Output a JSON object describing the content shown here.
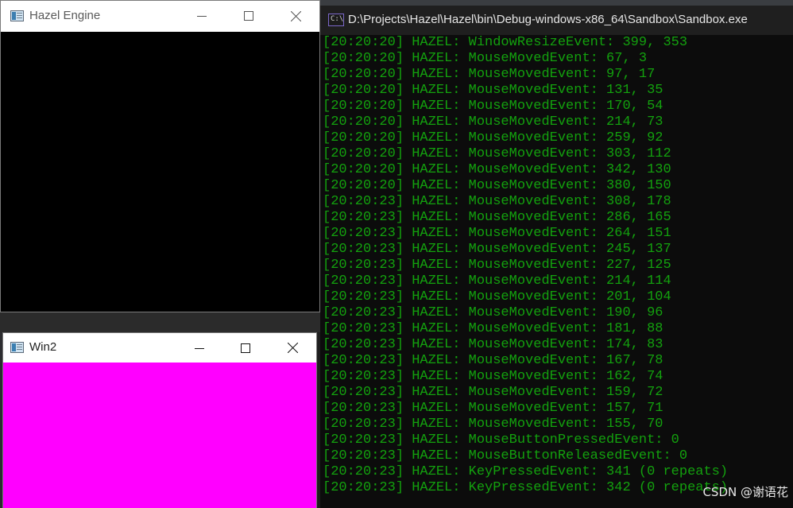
{
  "hazel_window": {
    "title": "Hazel Engine",
    "client_color": "#000000"
  },
  "win2_window": {
    "title": "Win2",
    "client_color": "#ff00ff"
  },
  "console_window": {
    "title": "D:\\Projects\\Hazel\\Hazel\\bin\\Debug-windows-x86_64\\Sandbox\\Sandbox.exe",
    "icon_text": "C:\\",
    "text_color": "#13a10e",
    "lines": [
      "[20:20:20] HAZEL: WindowResizeEvent: 399, 353",
      "[20:20:20] HAZEL: MouseMovedEvent: 67, 3",
      "[20:20:20] HAZEL: MouseMovedEvent: 97, 17",
      "[20:20:20] HAZEL: MouseMovedEvent: 131, 35",
      "[20:20:20] HAZEL: MouseMovedEvent: 170, 54",
      "[20:20:20] HAZEL: MouseMovedEvent: 214, 73",
      "[20:20:20] HAZEL: MouseMovedEvent: 259, 92",
      "[20:20:20] HAZEL: MouseMovedEvent: 303, 112",
      "[20:20:20] HAZEL: MouseMovedEvent: 342, 130",
      "[20:20:20] HAZEL: MouseMovedEvent: 380, 150",
      "[20:20:23] HAZEL: MouseMovedEvent: 308, 178",
      "[20:20:23] HAZEL: MouseMovedEvent: 286, 165",
      "[20:20:23] HAZEL: MouseMovedEvent: 264, 151",
      "[20:20:23] HAZEL: MouseMovedEvent: 245, 137",
      "[20:20:23] HAZEL: MouseMovedEvent: 227, 125",
      "[20:20:23] HAZEL: MouseMovedEvent: 214, 114",
      "[20:20:23] HAZEL: MouseMovedEvent: 201, 104",
      "[20:20:23] HAZEL: MouseMovedEvent: 190, 96",
      "[20:20:23] HAZEL: MouseMovedEvent: 181, 88",
      "[20:20:23] HAZEL: MouseMovedEvent: 174, 83",
      "[20:20:23] HAZEL: MouseMovedEvent: 167, 78",
      "[20:20:23] HAZEL: MouseMovedEvent: 162, 74",
      "[20:20:23] HAZEL: MouseMovedEvent: 159, 72",
      "[20:20:23] HAZEL: MouseMovedEvent: 157, 71",
      "[20:20:23] HAZEL: MouseMovedEvent: 155, 70",
      "[20:20:23] HAZEL: MouseButtonPressedEvent: 0",
      "[20:20:23] HAZEL: MouseButtonReleasedEvent: 0",
      "[20:20:23] HAZEL: KeyPressedEvent: 341 (0 repeats)",
      "[20:20:23] HAZEL: KeyPressedEvent: 342 (0 repeats)"
    ]
  },
  "icons": {
    "minimize": "minimize-icon",
    "maximize": "maximize-icon",
    "close": "close-icon",
    "app": "app-window-icon",
    "console": "console-icon"
  },
  "watermark": "CSDN @谢语花"
}
